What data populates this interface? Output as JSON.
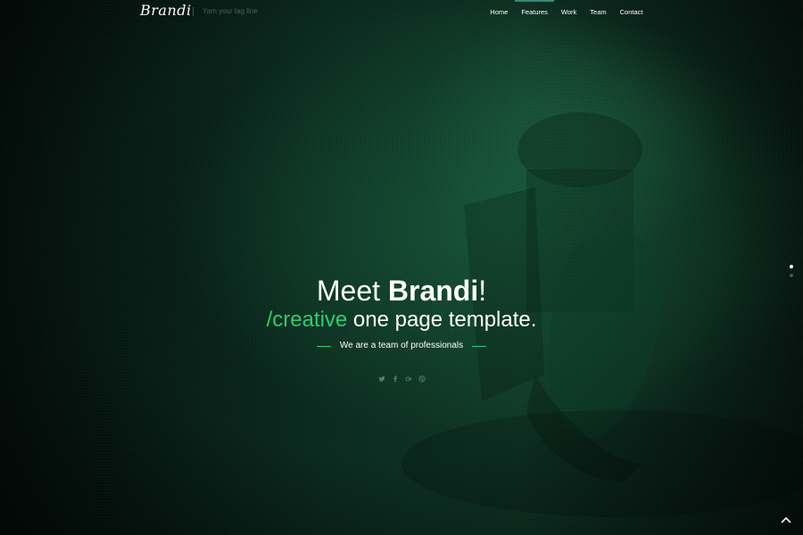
{
  "header": {
    "logo": "Brandi",
    "tagline": "Yam your tag line",
    "nav": [
      {
        "label": "Home"
      },
      {
        "label": "Features"
      },
      {
        "label": "Work"
      },
      {
        "label": "Team"
      },
      {
        "label": "Contact"
      }
    ],
    "active_nav": "Features"
  },
  "hero": {
    "title_prefix": "Meet ",
    "title_bold": "Brandi",
    "title_suffix": "!",
    "subtitle_accent": "/creative",
    "subtitle_rest": " one page template.",
    "lead": "We are a team of professionals",
    "socials": [
      "twitter-icon",
      "facebook-icon",
      "google-plus-icon",
      "dribbble-icon"
    ]
  },
  "pager": {
    "slides": 2,
    "active_slide": 1
  },
  "colors": {
    "accent": "#2ecc71",
    "nav_active_bar": "#2f8c78",
    "background": "#0b2a1f"
  }
}
